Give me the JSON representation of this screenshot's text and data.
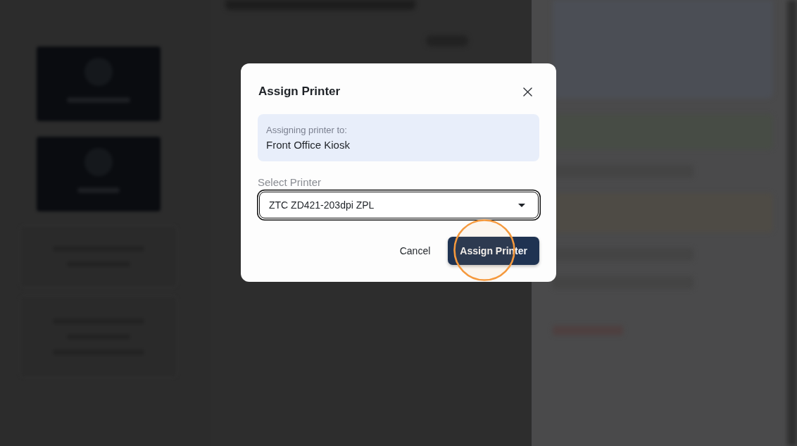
{
  "dialog": {
    "title": "Assign Printer",
    "target": {
      "label": "Assigning printer to:",
      "value": "Front Office Kiosk"
    },
    "printer_select": {
      "label": "Select Printer",
      "value": "ZTC ZD421-203dpi ZPL",
      "focused": true
    },
    "buttons": [
      {
        "label": "Cancel",
        "kind": "text",
        "highlighted": false
      },
      {
        "label": "Assign Printer",
        "kind": "primary",
        "highlighted": true
      }
    ]
  }
}
